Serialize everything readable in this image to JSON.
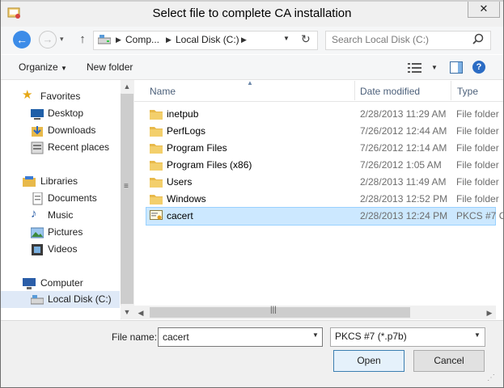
{
  "window": {
    "title": "Select file to complete CA installation",
    "close_label": "✕"
  },
  "nav": {
    "address_segments": [
      "Comp...",
      "Local Disk (C:)"
    ],
    "search_placeholder": "Search Local Disk (C:)"
  },
  "toolbar": {
    "organize_label": "Organize",
    "new_folder_label": "New folder"
  },
  "sidebar": {
    "favorites": {
      "label": "Favorites",
      "items": [
        "Desktop",
        "Downloads",
        "Recent places"
      ]
    },
    "libraries": {
      "label": "Libraries",
      "items": [
        "Documents",
        "Music",
        "Pictures",
        "Videos"
      ]
    },
    "computer": {
      "label": "Computer",
      "items": [
        "Local Disk (C:)"
      ],
      "selected": "Local Disk (C:)"
    }
  },
  "files": {
    "columns": [
      "Name",
      "Date modified",
      "Type"
    ],
    "rows": [
      {
        "name": "inetpub",
        "date": "2/28/2013 11:29 AM",
        "type": "File folder",
        "icon": "folder-icon"
      },
      {
        "name": "PerfLogs",
        "date": "7/26/2012 12:44 AM",
        "type": "File folder",
        "icon": "folder-icon"
      },
      {
        "name": "Program Files",
        "date": "7/26/2012 12:14 AM",
        "type": "File folder",
        "icon": "folder-icon"
      },
      {
        "name": "Program Files (x86)",
        "date": "7/26/2012 1:05 AM",
        "type": "File folder",
        "icon": "folder-icon"
      },
      {
        "name": "Users",
        "date": "2/28/2013 11:49 AM",
        "type": "File folder",
        "icon": "folder-icon"
      },
      {
        "name": "Windows",
        "date": "2/28/2013 12:52 PM",
        "type": "File folder",
        "icon": "folder-icon"
      },
      {
        "name": "cacert",
        "date": "2/28/2013 12:24 PM",
        "type": "PKCS #7 C",
        "icon": "certificate-icon",
        "selected": true
      }
    ]
  },
  "footer": {
    "file_name_label": "File name:",
    "file_name_value": "cacert",
    "filter_value": "PKCS #7 (*.p7b)",
    "open_label": "Open",
    "cancel_label": "Cancel"
  },
  "colors": {
    "selection": "#cce8ff",
    "accent": "#3c8ce8",
    "folder": "#e8b94a"
  }
}
